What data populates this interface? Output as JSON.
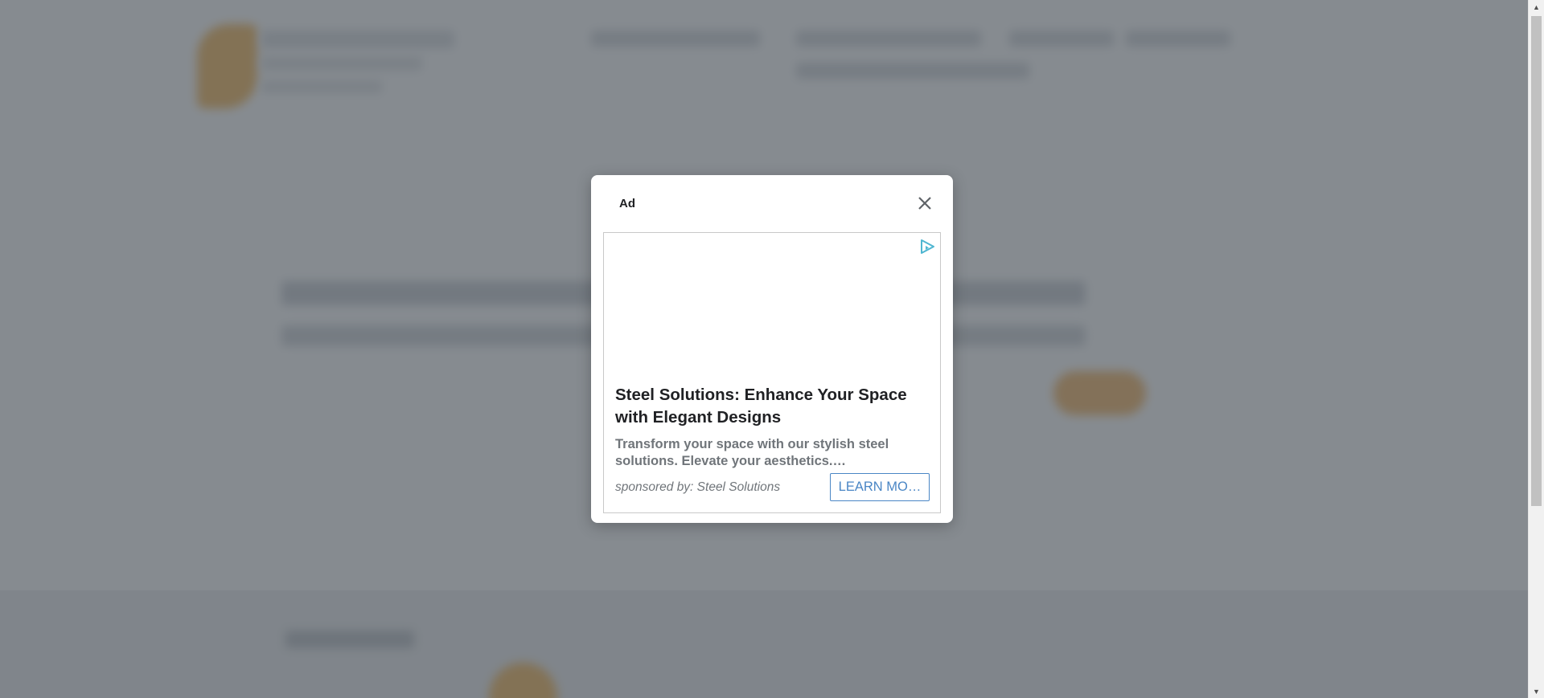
{
  "modal": {
    "title": "Ad",
    "close_icon": "close-icon",
    "adchoices_icon": "adchoices-icon"
  },
  "ad": {
    "headline": "Steel Solutions: Enhance Your Space with Elegant Designs",
    "body": "Transform your space with our stylish steel solutions. Elevate your aesthetics.…",
    "sponsor": "sponsored by: Steel Solutions",
    "cta_label": "LEARN MO…"
  },
  "scrollbar": {
    "up_icon": "scroll-up-arrow-icon",
    "down_icon": "scroll-down-arrow-icon"
  },
  "colors": {
    "overlay": "#585e65",
    "accent_orange": "#f3a52d",
    "cta_blue": "#4a86c5",
    "adchoices_teal": "#4fb6d1"
  }
}
